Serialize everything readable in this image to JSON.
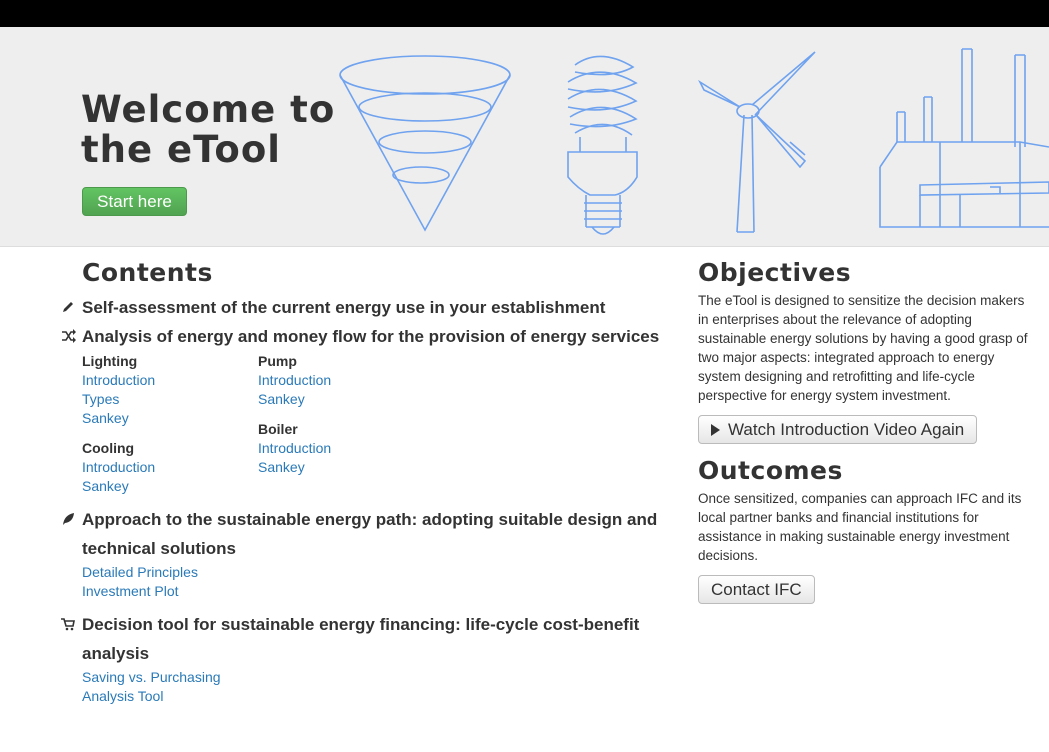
{
  "hero": {
    "title": "Welcome to\nthe eTool",
    "start_label": "Start here"
  },
  "contents": {
    "heading": "Contents",
    "sections": [
      {
        "icon": "pencil-icon",
        "title": "Self-assessment of the current energy use in your establishment"
      },
      {
        "icon": "shuffle-icon",
        "title": "Analysis of energy and money flow for the provision of energy services",
        "groups": [
          {
            "name": "Lighting",
            "links": [
              "Introduction",
              "Types",
              "Sankey"
            ]
          },
          {
            "name": "Cooling",
            "links": [
              "Introduction",
              "Sankey"
            ]
          },
          {
            "name": "Pump",
            "links": [
              "Introduction",
              "Sankey"
            ]
          },
          {
            "name": "Boiler",
            "links": [
              "Introduction",
              "Sankey"
            ]
          }
        ]
      },
      {
        "icon": "leaf-icon",
        "title": "Approach to the sustainable energy path: adopting suitable design and technical solutions",
        "links": [
          "Detailed Principles",
          "Investment Plot"
        ]
      },
      {
        "icon": "shopping-cart-icon",
        "title": "Decision tool for sustainable energy financing: life-cycle cost-benefit analysis",
        "links": [
          "Saving vs. Purchasing",
          "Analysis Tool"
        ]
      }
    ]
  },
  "objectives": {
    "heading": "Objectives",
    "text": "The eTool is designed to sensitize the decision makers in enterprises about the relevance of adopting sustainable energy solutions by having a good grasp of two major aspects: integrated approach to energy system designing and retrofitting and life-cycle perspective for energy system investment.",
    "video_button": "Watch Introduction Video Again"
  },
  "outcomes": {
    "heading": "Outcomes",
    "text": "Once sensitized, companies can approach IFC and its local partner banks and financial institutions for assistance in making sustainable energy investment decisions.",
    "contact_button": "Contact IFC"
  },
  "colors": {
    "accent_link": "#2a7ab8",
    "start_button": "#5bb75b",
    "illustration_stroke": "#6fa2ef"
  }
}
